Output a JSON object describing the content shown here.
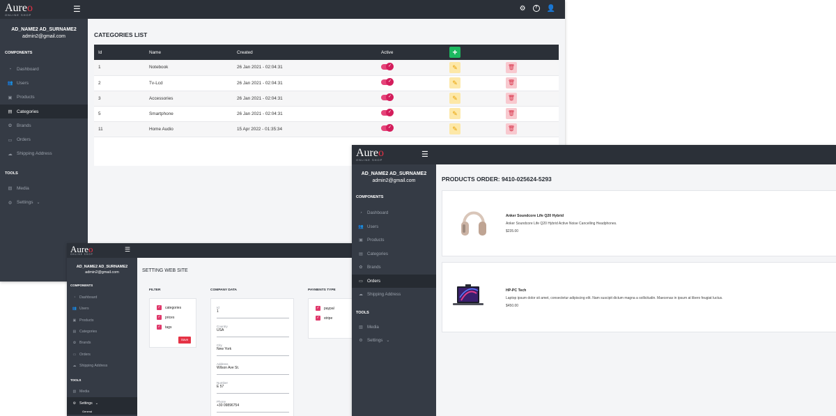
{
  "brand": {
    "name_main": "Aure",
    "name_accent": "o",
    "tagline": "ONLINE SHOP"
  },
  "user": {
    "name": "AD_NAME2 AD_SURNAME2",
    "email": "admin2@gmail.com"
  },
  "sidebar": {
    "components_label": "COMPONENTS",
    "tools_label": "TOOLS",
    "items": [
      "Dashboard",
      "Users",
      "Products",
      "Categories",
      "Brands",
      "Orders",
      "Shipping Address"
    ],
    "tools": [
      "Media",
      "Settings"
    ],
    "settings_sub": [
      "General"
    ]
  },
  "categories": {
    "title": "CATEGORIES LIST",
    "columns": [
      "Id",
      "Name",
      "Created",
      "Active"
    ],
    "rows": [
      {
        "id": "1",
        "name": "Notebook",
        "created": "26 Jan 2021 - 02:04:31"
      },
      {
        "id": "2",
        "name": "Tv-Lcd",
        "created": "26 Jan 2021 - 02:04:31"
      },
      {
        "id": "3",
        "name": "Accessories",
        "created": "26 Jan 2021 - 02:04:31"
      },
      {
        "id": "5",
        "name": "Smartphone",
        "created": "26 Jan 2021 - 02:04:31"
      },
      {
        "id": "11",
        "name": "Home Audio",
        "created": "15 Apr 2022 - 01:35:34"
      }
    ]
  },
  "settings": {
    "title": "SETTING WEB SITE",
    "filter_label": "FILTER",
    "filters": [
      "categories",
      "prices",
      "tags"
    ],
    "save_label": "Save",
    "company_label": "COMPANY DATA",
    "company_fields": [
      {
        "label": "Id",
        "value": "1"
      },
      {
        "label": "Country",
        "value": "USA"
      },
      {
        "label": "City",
        "value": "New York"
      },
      {
        "label": "Address",
        "value": "Wilson Ave St."
      },
      {
        "label": "Number",
        "value": "E 57"
      },
      {
        "label": "Phone",
        "value": "+30 09896754"
      }
    ],
    "payments_label": "PAYMENTS TYPE",
    "payments": [
      "paypal",
      "stripe"
    ]
  },
  "order": {
    "title": "PRODUCTS ORDER: 9410-025624-5293",
    "products": [
      {
        "name": "Anker Soundcore Life Q20 Hybrid",
        "description": "Anker Soundcore Life Q20 Hybrid Active Noise Cancelling Headphones.",
        "price": "$235.00",
        "image": "headphones-image"
      },
      {
        "name": "HP-PC Tech",
        "description": "Laptop ipsum dolor sit amet, consectetur adipiscing elit. Nam suscipit dictum magna a sollicitudin. Maecenas in ipsum at libero feugiat luctus.",
        "price": "$450.00",
        "image": "laptop-image"
      }
    ]
  },
  "colors": {
    "topbar": "#2b3038",
    "sidebar": "#353b45",
    "accent": "#e53245",
    "add": "#1db960",
    "edit": "#fde8a8",
    "delete": "#f8c9cf",
    "toggle": "#d41e5c"
  },
  "icons": [
    "menu-icon",
    "gear-icon",
    "help-icon",
    "user-icon",
    "plus-icon",
    "pencil-icon",
    "trash-icon",
    "chevron-down-icon"
  ]
}
